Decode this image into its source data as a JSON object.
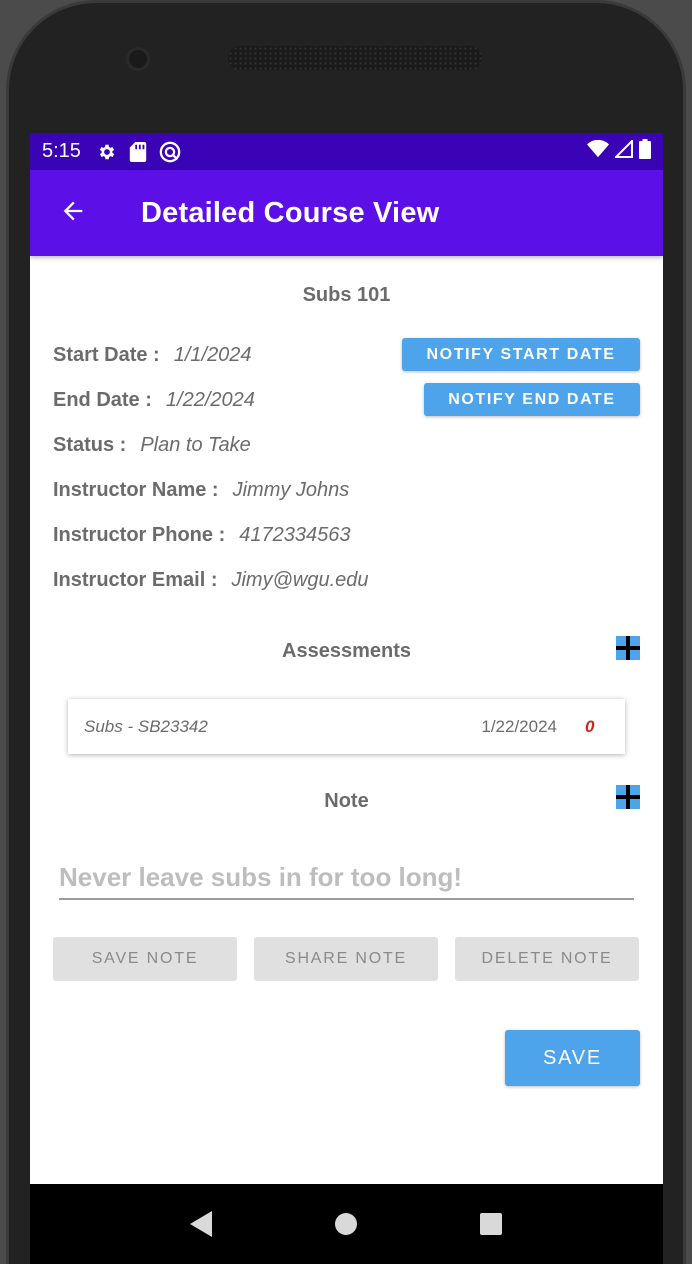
{
  "status_bar": {
    "time": "5:15",
    "left_icons": [
      "gear-icon",
      "sd-card-icon",
      "sync-icon"
    ],
    "right_icons": [
      "wifi-icon",
      "cell-signal-icon",
      "battery-icon"
    ]
  },
  "app_bar": {
    "title": "Detailed Course View"
  },
  "course": {
    "title": "Subs 101",
    "start_date_label": "Start Date :",
    "start_date": "1/1/2024",
    "end_date_label": "End Date :",
    "end_date": "1/22/2024",
    "status_label": "Status :",
    "status": "Plan to Take",
    "instructor_name_label": "Instructor Name :",
    "instructor_name": "Jimmy Johns",
    "instructor_phone_label": "Instructor Phone :",
    "instructor_phone": "4172334563",
    "instructor_email_label": "Instructor Email :",
    "instructor_email": "Jimy@wgu.edu"
  },
  "buttons": {
    "notify_start": "NOTIFY START DATE",
    "notify_end": "NOTIFY END DATE",
    "save_note": "SAVE NOTE",
    "share_note": "SHARE NOTE",
    "delete_note": "DELETE NOTE",
    "save": "SAVE"
  },
  "assessments": {
    "header": "Assessments",
    "items": [
      {
        "name": "Subs - SB23342",
        "date": "1/22/2024",
        "count": "0"
      }
    ]
  },
  "note": {
    "header": "Note",
    "placeholder": "Never leave subs in for too long!",
    "value": ""
  },
  "colors": {
    "status_bar": "#3a03b5",
    "app_bar": "#5c0fe6",
    "accent_button": "#4ea4ea",
    "grey_button": "#e0e0e0",
    "count_red": "#d62020"
  }
}
